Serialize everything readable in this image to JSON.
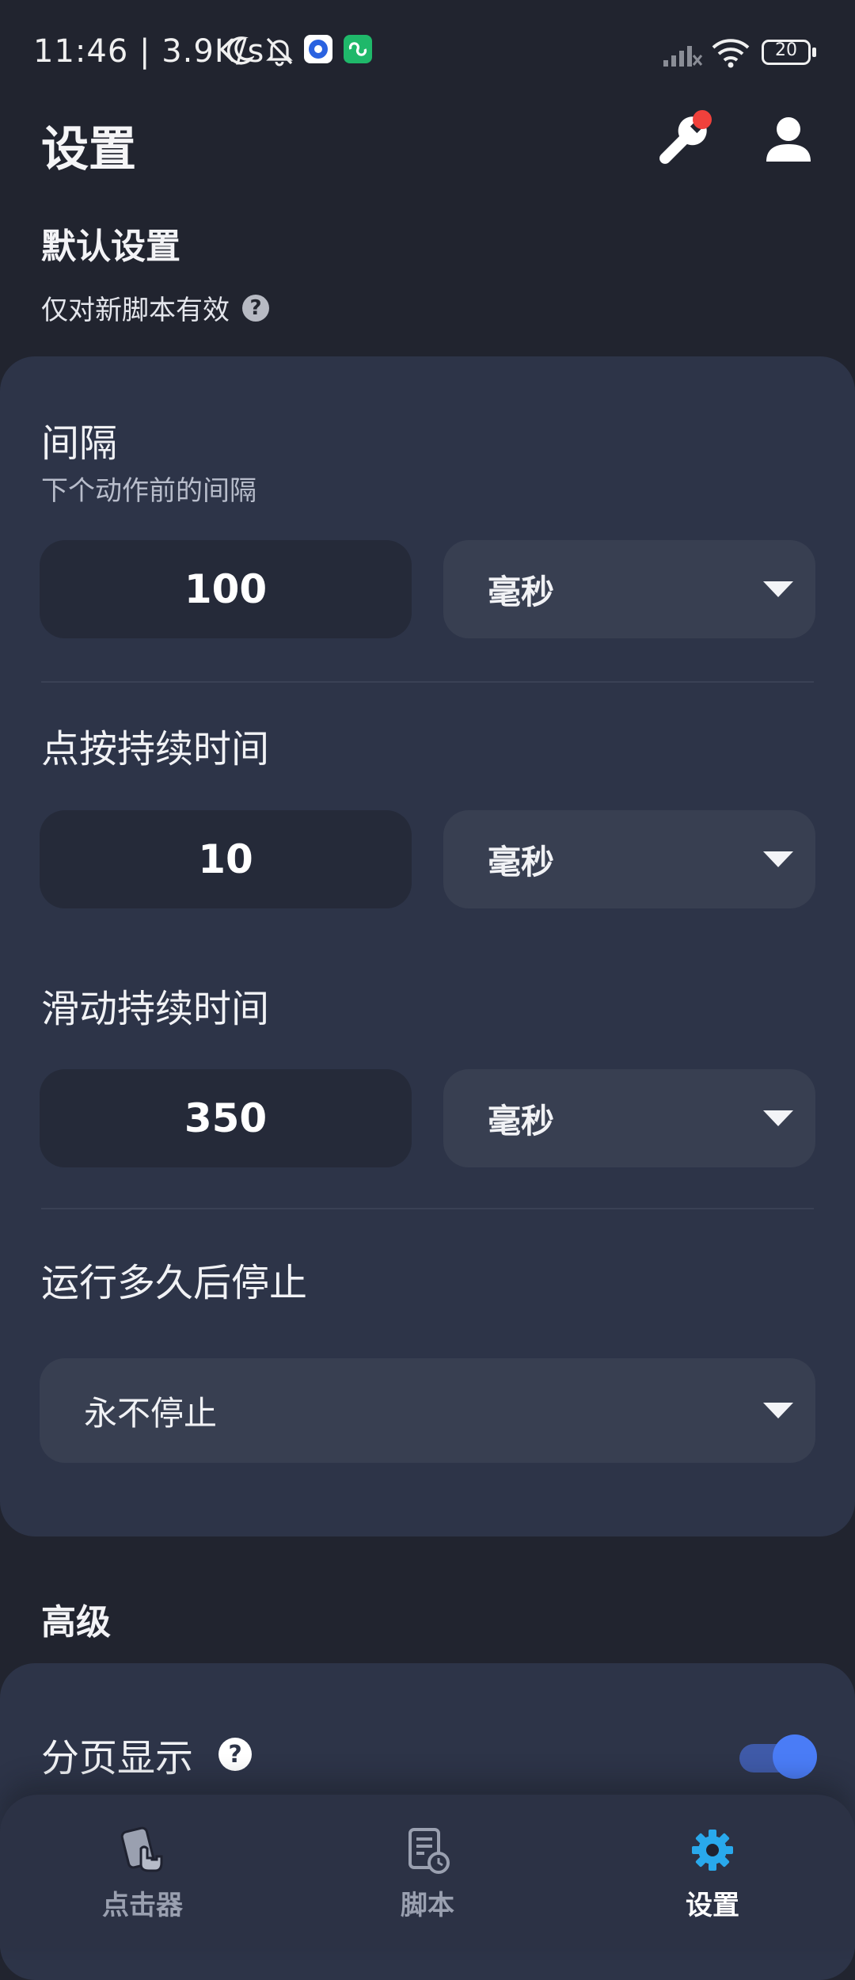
{
  "status_bar": {
    "time": "11:46",
    "speed": "3.9K/s",
    "battery": "20"
  },
  "header": {
    "title": "设置"
  },
  "default_settings": {
    "heading": "默认设置",
    "subtitle": "仅对新脚本有效",
    "help_glyph": "?"
  },
  "interval": {
    "title": "间隔",
    "hint": "下个动作前的间隔",
    "value": "100",
    "unit": "毫秒"
  },
  "tap_duration": {
    "title": "点按持续时间",
    "value": "10",
    "unit": "毫秒"
  },
  "swipe_duration": {
    "title": "滑动持续时间",
    "value": "350",
    "unit": "毫秒"
  },
  "stop_after": {
    "title": "运行多久后停止",
    "value": "永不停止"
  },
  "advanced": {
    "heading": "高级",
    "paging": {
      "label": "分页显示",
      "help_glyph": "?",
      "enabled": true
    }
  },
  "bottom_nav": {
    "items": [
      {
        "label": "点击器",
        "icon": "clicker-icon",
        "active": false
      },
      {
        "label": "脚本",
        "icon": "script-icon",
        "active": false
      },
      {
        "label": "设置",
        "icon": "gear-icon",
        "active": true
      }
    ]
  },
  "colors": {
    "accent": "#4a7cf6",
    "active_nav_icon": "#29a9ec",
    "notification_dot": "#f0413c"
  }
}
